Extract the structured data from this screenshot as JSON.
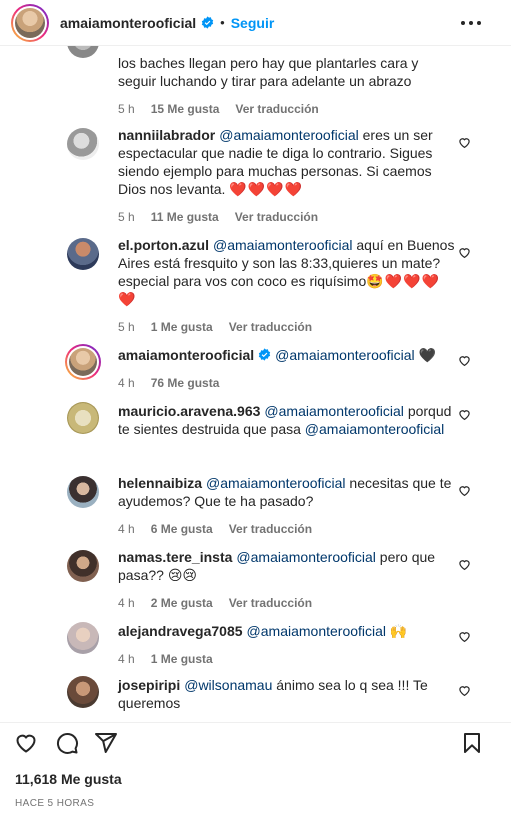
{
  "header": {
    "username": "amaiamonterooficial",
    "separator": "•",
    "follow_label": "Seguir"
  },
  "comments": [
    {
      "user": "",
      "text": "los baches llegan pero hay que plantarles cara y seguir luchando y tirar para adelante un abrazo",
      "time": "5 h",
      "likes": "15 Me gusta",
      "translate": "Ver traducción"
    },
    {
      "user": "nanniilabrador",
      "mention": "@amaiamonterooficial",
      "text": "eres un ser espectacular que nadie te diga lo contrario. Sigues siendo ejemplo para muchas personas. Si caemos Dios nos levanta.",
      "emoji": "❤️❤️❤️❤️",
      "time": "5 h",
      "likes": "11 Me gusta",
      "translate": "Ver traducción"
    },
    {
      "user": "el.porton.azul",
      "mention": "@amaiamonterooficial",
      "text": "aquí en Buenos Aires está fresquito y son las 8:33,quieres un mate? especial para vos con coco es riquísimo",
      "emoji": "🤩❤️❤️❤️❤️",
      "time": "5 h",
      "likes": "1 Me gusta",
      "translate": "Ver traducción"
    },
    {
      "user": "amaiamonterooficial",
      "mention": "@amaiamonterooficial",
      "text": "",
      "emoji": "🖤",
      "time": "4 h",
      "likes": "76 Me gusta",
      "translate": ""
    },
    {
      "user": "mauricio.aravena.963",
      "mention": "@amaiamonterooficial",
      "text": "porqud te sientes destruida que pasa",
      "mention2": "@amaiamonterooficial",
      "time": "",
      "likes": "",
      "translate": ""
    },
    {
      "user": "helennaibiza",
      "mention": "@amaiamonterooficial",
      "text": "necesitas que te ayudemos? Que te ha pasado?",
      "time": "4 h",
      "likes": "6 Me gusta",
      "translate": "Ver traducción"
    },
    {
      "user": "namas.tere_insta",
      "mention": "@amaiamonterooficial",
      "text": "pero que pasa??",
      "emoji": "😢😢",
      "time": "4 h",
      "likes": "2 Me gusta",
      "translate": "Ver traducción"
    },
    {
      "user": "alejandravega7085",
      "mention": "@amaiamonterooficial",
      "text": "",
      "emoji": "🙌",
      "time": "4 h",
      "likes": "1 Me gusta",
      "translate": ""
    },
    {
      "user": "josepiripi",
      "mention": "@wilsonamau",
      "text": "ánimo sea lo q sea !!! Te queremos",
      "time": "",
      "likes": "",
      "translate": ""
    }
  ],
  "actions": {
    "likes": "11,618 Me gusta",
    "time": "HACE 5 HORAS"
  },
  "colors": {
    "link": "#0095f6",
    "mention": "#00376b",
    "heart": "#ed4956",
    "meta": "#737373"
  },
  "icons": [
    "verified-badge-icon",
    "more-options-icon",
    "heart-icon",
    "comment-icon",
    "share-icon",
    "bookmark-icon"
  ]
}
